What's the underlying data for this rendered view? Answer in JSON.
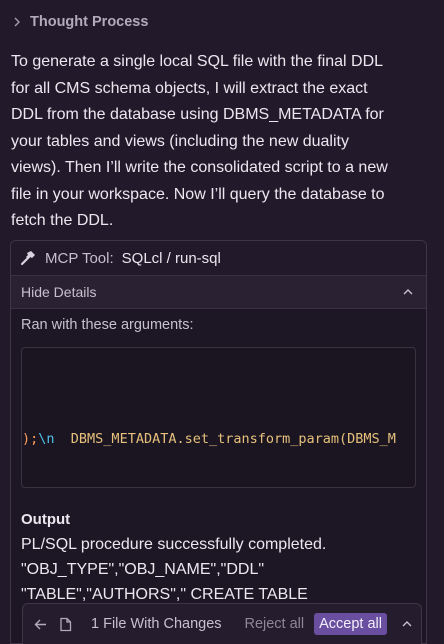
{
  "thought": {
    "label": "Thought Process"
  },
  "message": {
    "lines": [
      "To generate a single local SQL file with the final DDL",
      "for all CMS schema objects, I will extract the exact",
      "DDL from the database using DBMS_METADATA for",
      "your tables and views (including the new duality",
      "views). Then I’ll write the consolidated script to a new",
      "file in your workspace. Now I’ll query the database to",
      "fetch the DDL."
    ]
  },
  "tool": {
    "prefix": "MCP Tool:",
    "name": "SQLcl / run-sql",
    "details_toggle": "Hide Details",
    "args_label": "Ran with these arguments:",
    "code": {
      "paren": ");",
      "escape": "\\n",
      "call": "DBMS_METADATA.set_transform_param(DBMS_M"
    },
    "output_label": "Output",
    "output_lines": [
      "PL/SQL procedure successfully completed.",
      "\"OBJ_TYPE\",\"OBJ_NAME\",\"DDL\"",
      "\"TABLE\",\"AUTHORS\",\" CREATE TABLE"
    ]
  },
  "changes": {
    "count_label": "1 File With Changes",
    "reject_label": "Reject all",
    "accept_label": "Accept all"
  },
  "icons": {
    "thought_toggle": "chevron-right-icon",
    "tool": "hammer-icon",
    "details": "chevron-up-icon",
    "back": "arrow-left-icon",
    "file": "file-icon",
    "expand": "chevron-up-icon"
  },
  "colors": {
    "background": "#221a2b",
    "accent": "#6a4ea0",
    "code_paren": "#ff9d5c",
    "code_escape": "#4fc1e9",
    "code_function": "#e6c07b"
  }
}
